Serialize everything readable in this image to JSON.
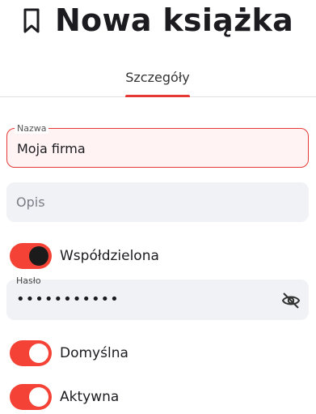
{
  "header": {
    "title": "Nowa książka",
    "icon": "bookmark-icon"
  },
  "tabs": [
    {
      "label": "Szczegóły",
      "active": true
    }
  ],
  "form": {
    "name": {
      "label": "Nazwa",
      "value": "Moja firma"
    },
    "description": {
      "placeholder": "Opis"
    },
    "shared": {
      "label": "Współdzielona",
      "on": true
    },
    "password": {
      "label": "Hasło",
      "value": "•••••••••••",
      "icon": "eye-off-icon"
    },
    "default": {
      "label": "Domyślna",
      "on": true
    },
    "active": {
      "label": "Aktywna",
      "on": true
    }
  },
  "colors": {
    "accent": "#e53935",
    "switch_track": "#f44336",
    "field_bg": "#f1f2f6"
  }
}
